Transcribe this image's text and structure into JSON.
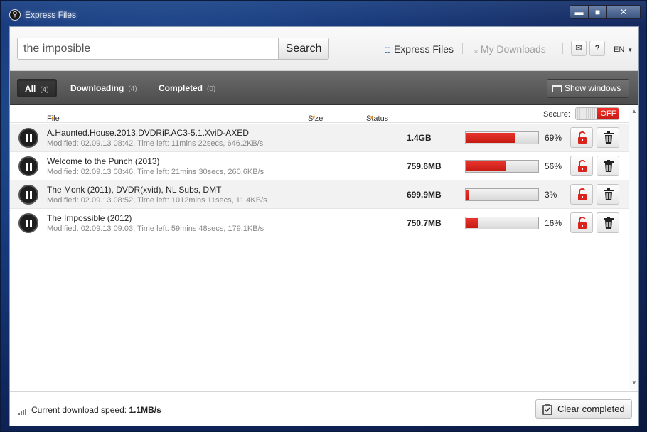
{
  "window": {
    "title": "Express Files",
    "min_glyph": "▬",
    "max_glyph": "■",
    "close_glyph": "✕"
  },
  "header": {
    "search_value": "the imposible",
    "search_button": "Search",
    "nav_express": "Express Files",
    "nav_downloads": "My Downloads",
    "feedback_glyph": "✉",
    "help_glyph": "?",
    "language": "EN"
  },
  "tabs": [
    {
      "label": "All",
      "count": "(4)"
    },
    {
      "label": "Downloading",
      "count": "(4)"
    },
    {
      "label": "Completed",
      "count": "(0)"
    }
  ],
  "show_windows": "Show windows",
  "columns": {
    "file": "File",
    "size": "Size",
    "status": "Status",
    "secure": "Secure:",
    "secure_state": "OFF"
  },
  "downloads": [
    {
      "name": "A.Haunted.House.2013.DVDRiP.AC3-5.1.XviD-AXED",
      "meta": "Modified: 02.09.13 08:42,  Time left: 11mins 22secs,  646.2KB/s",
      "size": "1.4GB",
      "progress": 69,
      "percent": "69%"
    },
    {
      "name": "Welcome to the Punch (2013)",
      "meta": "Modified: 02.09.13 08:46,  Time left: 21mins 30secs,  260.6KB/s",
      "size": "759.6MB",
      "progress": 56,
      "percent": "56%"
    },
    {
      "name": "The Monk (2011), DVDR(xvid), NL Subs, DMT",
      "meta": "Modified: 02.09.13 08:52,  Time left: 1012mins 11secs,  11.4KB/s",
      "size": "699.9MB",
      "progress": 3,
      "percent": "3%"
    },
    {
      "name": "The Impossible (2012)",
      "meta": "Modified: 02.09.13 09:03,  Time left: 59mins 48secs,  179.1KB/s",
      "size": "750.7MB",
      "progress": 16,
      "percent": "16%"
    }
  ],
  "footer": {
    "speed_label": "Current download speed:",
    "speed_value": "1.1MB/s",
    "clear_button": "Clear completed"
  },
  "colors": {
    "accent_red": "#d9231c",
    "sort_arrow": "#f08c1a"
  }
}
